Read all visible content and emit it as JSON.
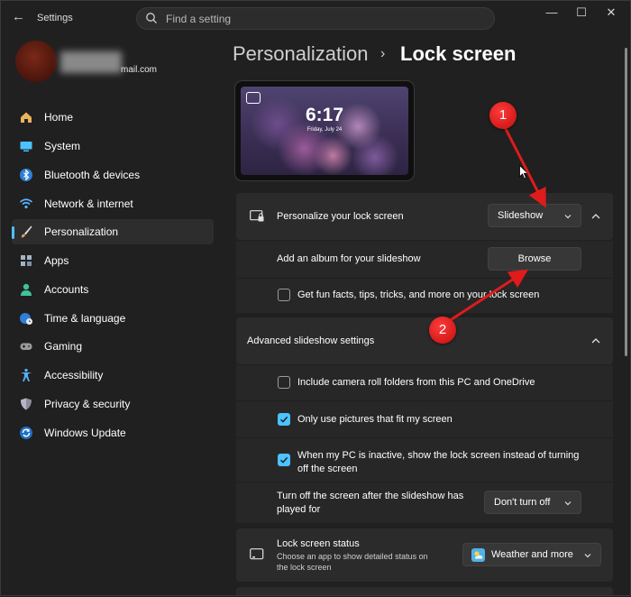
{
  "window": {
    "title": "Settings",
    "back_glyph": "←",
    "min_glyph": "—",
    "max_glyph": "☐",
    "close_glyph": "✕"
  },
  "search": {
    "placeholder": "Find a setting"
  },
  "profile": {
    "email_suffix": "mail.com"
  },
  "sidebar": {
    "items": [
      {
        "label": "Home",
        "icon": "home-icon",
        "color": "#e8b35a"
      },
      {
        "label": "System",
        "icon": "monitor-icon",
        "color": "#4cc2ff"
      },
      {
        "label": "Bluetooth & devices",
        "icon": "bluetooth-icon",
        "color": "#4aa3f0"
      },
      {
        "label": "Network & internet",
        "icon": "wifi-icon",
        "color": "#5ab4ff"
      },
      {
        "label": "Personalization",
        "icon": "brush-icon",
        "color": "#e6a05c",
        "active": true
      },
      {
        "label": "Apps",
        "icon": "apps-icon",
        "color": "#a3b3c4"
      },
      {
        "label": "Accounts",
        "icon": "person-icon",
        "color": "#3dc29a"
      },
      {
        "label": "Time & language",
        "icon": "globe-clock-icon",
        "color": "#4aa3f0"
      },
      {
        "label": "Gaming",
        "icon": "gamepad-icon",
        "color": "#9a9a9a"
      },
      {
        "label": "Accessibility",
        "icon": "accessibility-icon",
        "color": "#56b0f0"
      },
      {
        "label": "Privacy & security",
        "icon": "shield-icon",
        "color": "#8c8c9c"
      },
      {
        "label": "Windows Update",
        "icon": "update-icon",
        "color": "#3a8ee6"
      }
    ]
  },
  "header": {
    "parent": "Personalization",
    "separator": "›",
    "current": "Lock screen"
  },
  "preview": {
    "time": "6:17",
    "date": "Friday, July 24"
  },
  "personalize": {
    "label": "Personalize your lock screen",
    "value": "Slideshow"
  },
  "album": {
    "label": "Add an album for your slideshow",
    "button": "Browse"
  },
  "fun_facts": {
    "label": "Get fun facts, tips, tricks, and more on your lock screen",
    "checked": false
  },
  "advanced": {
    "label": "Advanced slideshow settings"
  },
  "camera_roll": {
    "label": "Include camera roll folders from this PC and OneDrive",
    "checked": false
  },
  "fit_pictures": {
    "label": "Only use pictures that fit my screen",
    "checked": true
  },
  "inactive": {
    "line1": "When my PC is inactive, show the lock screen instead of turning",
    "line2": "off the screen",
    "checked": true
  },
  "turn_off": {
    "line1": "Turn off the screen after the slideshow has",
    "line2": "played for",
    "value": "Don't turn off"
  },
  "status": {
    "label": "Lock screen status",
    "desc1": "Choose an app to show detailed status on",
    "desc2": "the lock screen",
    "value": "Weather and more"
  },
  "annotations": {
    "marker1": "1",
    "marker2": "2",
    "color": "#e01b1b"
  },
  "colors": {
    "accent": "#4cc2ff",
    "background": "#202020",
    "card": "#2b2b2b"
  }
}
